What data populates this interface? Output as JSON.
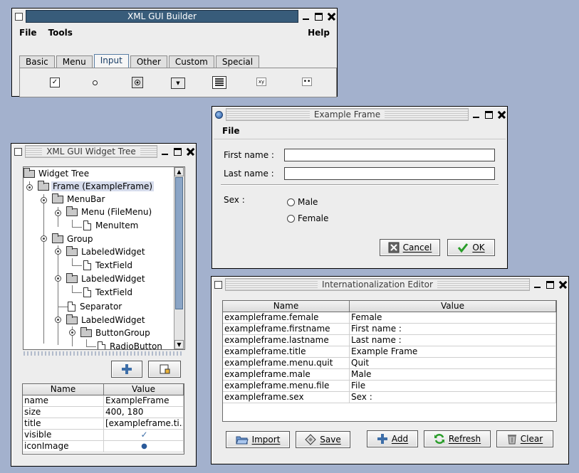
{
  "builder": {
    "title": "XML GUI Builder",
    "menu": [
      "File",
      "Tools",
      "Help"
    ],
    "tabs": [
      "Basic",
      "Menu",
      "Input",
      "Other",
      "Custom",
      "Special"
    ],
    "selected_tab": "Input",
    "palette": {
      "checkbox_glyph": "✓",
      "combo_glyph": "▼",
      "xy_label": "xy",
      "dots_label": "••"
    }
  },
  "tree": {
    "title": "XML GUI Widget Tree",
    "nodes": [
      {
        "label": "Widget Tree",
        "icon": "folder"
      },
      {
        "label": "Frame (ExampleFrame)",
        "icon": "folder",
        "selected": true
      },
      {
        "label": "MenuBar",
        "icon": "folder"
      },
      {
        "label": "Menu (FileMenu)",
        "icon": "folder"
      },
      {
        "label": "MenuItem",
        "icon": "file"
      },
      {
        "label": "Group",
        "icon": "folder"
      },
      {
        "label": "LabeledWidget",
        "icon": "folder"
      },
      {
        "label": "TextField",
        "icon": "file"
      },
      {
        "label": "LabeledWidget",
        "icon": "folder"
      },
      {
        "label": "TextField",
        "icon": "file"
      },
      {
        "label": "Separator",
        "icon": "file"
      },
      {
        "label": "LabeledWidget",
        "icon": "folder"
      },
      {
        "label": "ButtonGroup",
        "icon": "folder"
      },
      {
        "label": "RadioButton",
        "icon": "file"
      }
    ],
    "add_icon": "plus-icon",
    "edit_icon": "edit-icon",
    "properties": {
      "headers": [
        "Name",
        "Value"
      ],
      "rows": [
        {
          "name": "name",
          "value": "ExampleFrame"
        },
        {
          "name": "size",
          "value": "400, 180"
        },
        {
          "name": "title",
          "value": "[exampleframe.ti..."
        },
        {
          "name": "visible",
          "value": "✓"
        },
        {
          "name": "iconImage",
          "value": "●"
        }
      ]
    }
  },
  "example": {
    "title": "Example Frame",
    "menu": [
      "File"
    ],
    "first_name_label": "First name :",
    "first_name_value": "",
    "last_name_label": "Last name :",
    "last_name_value": "",
    "sex_label": "Sex :",
    "male_label": "Male",
    "female_label": "Female",
    "cancel_label": "Cancel",
    "ok_label": "OK"
  },
  "i18n": {
    "title": "Internationalization Editor",
    "headers": [
      "Name",
      "Value"
    ],
    "rows": [
      {
        "name": "exampleframe.female",
        "value": "Female"
      },
      {
        "name": "exampleframe.firstname",
        "value": "First name :"
      },
      {
        "name": "exampleframe.lastname",
        "value": "Last name :"
      },
      {
        "name": "exampleframe.title",
        "value": "Example Frame"
      },
      {
        "name": "exampleframe.menu.quit",
        "value": "Quit"
      },
      {
        "name": "exampleframe.male",
        "value": "Male"
      },
      {
        "name": "exampleframe.menu.file",
        "value": "File"
      },
      {
        "name": "exampleframe.sex",
        "value": "Sex :"
      }
    ],
    "buttons": {
      "import": "Import",
      "save": "Save",
      "add": "Add",
      "refresh": "Refresh",
      "clear": "Clear"
    }
  },
  "colors": {
    "desktop": "#a3b1cd",
    "active_title": "#385c7a",
    "selection": "#d6dcec",
    "ok_check": "#2a9d2a"
  }
}
